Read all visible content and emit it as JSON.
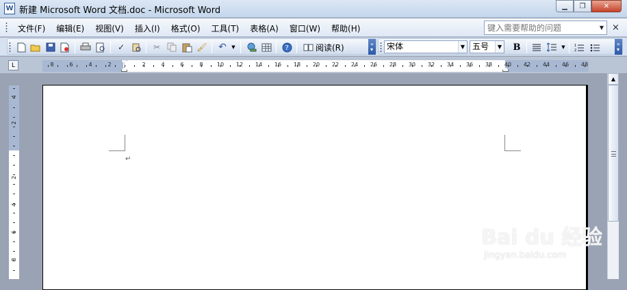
{
  "window": {
    "title": "新建 Microsoft Word 文档.doc - Microsoft Word",
    "icon_glyph": "W",
    "minimize_glyph": "▁",
    "restore_glyph": "❐",
    "close_glyph": "✕"
  },
  "menubar": {
    "items": [
      {
        "label": "文件(F)"
      },
      {
        "label": "编辑(E)"
      },
      {
        "label": "视图(V)"
      },
      {
        "label": "插入(I)"
      },
      {
        "label": "格式(O)"
      },
      {
        "label": "工具(T)"
      },
      {
        "label": "表格(A)"
      },
      {
        "label": "窗口(W)"
      },
      {
        "label": "帮助(H)"
      }
    ],
    "help_placeholder": "键入需要帮助的问题",
    "close_doc_glyph": "×"
  },
  "toolbar": {
    "read_label": "阅读(R)",
    "font_name": "宋体",
    "font_size": "五号",
    "bold_glyph": "B",
    "icons": {
      "new": "new-document-icon",
      "open": "open-folder-icon",
      "save": "save-icon",
      "permission": "permission-icon",
      "print": "print-icon",
      "print_preview": "print-preview-icon",
      "spelling": "spelling-grammar-icon",
      "research": "research-icon",
      "cut": "cut-icon",
      "copy": "copy-icon",
      "paste": "paste-icon",
      "format_painter": "format-painter-icon",
      "undo": "undo-icon",
      "hyperlink": "insert-hyperlink-icon",
      "table": "tables-borders-icon",
      "help": "help-icon",
      "align": "align-icon",
      "line_spacing": "line-spacing-icon",
      "numbering": "numbering-icon",
      "bullets": "bullets-icon"
    }
  },
  "ruler": {
    "tab_selector": "L",
    "left_labels": [
      "8",
      "6",
      "4",
      "2"
    ],
    "right_labels": [
      "2",
      "4",
      "6",
      "8",
      "10",
      "12",
      "14",
      "16",
      "18",
      "20",
      "22",
      "24",
      "26",
      "28",
      "30",
      "32",
      "34",
      "36",
      "38",
      "40",
      "42",
      "44",
      "46",
      "48"
    ],
    "vertical_labels": [
      "4",
      "2",
      "2",
      "4",
      "6",
      "8"
    ]
  },
  "document": {
    "paragraph_mark": "↵"
  },
  "watermark": {
    "main": "Bai du 经验",
    "sub": "jingyan.baidu.com"
  },
  "colors": {
    "titlebar": "#c4d6ec",
    "workspace": "#9aa3b3",
    "ruler_margin": "#a8b8d3"
  }
}
